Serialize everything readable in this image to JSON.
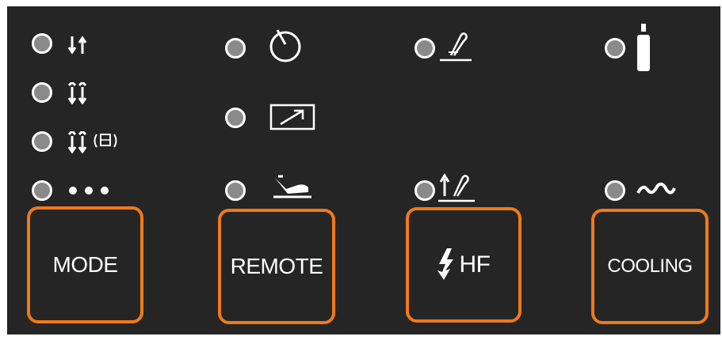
{
  "panel": {
    "background": "#252525",
    "accent": "#f07a17",
    "led_off_color": "#8a8a8a"
  },
  "mode": {
    "button_label": "MODE",
    "indicators": [
      {
        "icon": "two-step-icon"
      },
      {
        "icon": "four-step-icon"
      },
      {
        "icon": "four-step-bilevel-icon"
      },
      {
        "icon": "spot-dots-icon"
      }
    ]
  },
  "remote": {
    "button_label": "REMOTE",
    "indicators": [
      {
        "icon": "dial-knob-icon"
      },
      {
        "icon": "remote-box-icon"
      },
      {
        "icon": "foot-pedal-icon"
      }
    ]
  },
  "hf": {
    "button_label": "HF",
    "button_icon": "lightning-bolt-icon",
    "indicators": [
      {
        "icon": "hf-torch-icon"
      },
      {
        "icon": "lift-arc-torch-icon"
      }
    ]
  },
  "cooling": {
    "button_label": "COOLING",
    "indicators": [
      {
        "icon": "gas-bottle-icon"
      },
      {
        "icon": "water-wave-icon"
      }
    ]
  }
}
